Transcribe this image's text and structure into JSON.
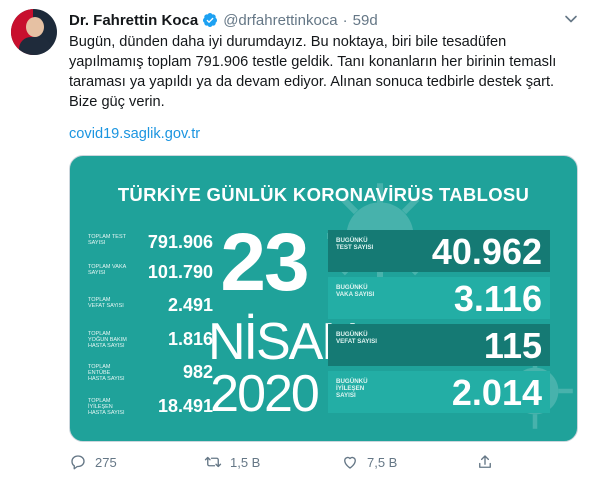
{
  "tweet": {
    "name": "Dr. Fahrettin Koca",
    "handle": "@drfahrettinkoca",
    "separator": "·",
    "time": "59d",
    "text_lines": [
      "Bugün, dünden daha iyi durumdayız. Bu noktaya, biri bile tesadüfen",
      "yapılmamış toplam 791.906 testle geldik. Tanı konanların her birinin temaslı",
      "taraması ya yapıldı ya da devam ediyor. Alınan sonuca tedbirle destek şart.",
      "Bize güç verin."
    ],
    "link": "covid19.saglik.gov.tr"
  },
  "card": {
    "title": "TÜRKİYE GÜNLÜK KORONAVİRÜS TABLOSU",
    "day": "23",
    "month": "NİSAN",
    "year": "2020",
    "totals": [
      {
        "label": "TOPLAM TEST SAYISI",
        "value": "791.906"
      },
      {
        "label": "TOPLAM VAKA SAYISI",
        "value": "101.790"
      },
      {
        "label": "TOPLAM VEFAT SAYISI",
        "value": "2.491"
      },
      {
        "label": "TOPLAM YOĞUN BAKIM HASTA SAYISI",
        "value": "1.816"
      },
      {
        "label": "TOPLAM ENTÜBE HASTA SAYISI",
        "value": "982"
      },
      {
        "label": "TOPLAM İYİLEŞEN HASTA SAYISI",
        "value": "18.491"
      }
    ],
    "daily": [
      {
        "label": "BUGÜNKÜ TEST SAYISI",
        "value": "40.962"
      },
      {
        "label": "BUGÜNKÜ VAKA SAYISI",
        "value": "3.116"
      },
      {
        "label": "BUGÜNKÜ VEFAT SAYISI",
        "value": "115"
      },
      {
        "label": "BUGÜNKÜ İYİLEŞEN SAYISI",
        "value": "2.014"
      }
    ]
  },
  "actions": {
    "reply_count": "275",
    "retweet_count": "1,5 B",
    "like_count": "7,5 B",
    "icons": [
      "reply-icon",
      "retweet-icon",
      "like-icon",
      "share-icon"
    ]
  },
  "colors": {
    "card_bg": "#1fa29a",
    "panel_dark": "#157a74",
    "panel_light": "#23aea5",
    "link": "#1b95e0",
    "verified": "#1da1f2",
    "muted": "#657786"
  }
}
